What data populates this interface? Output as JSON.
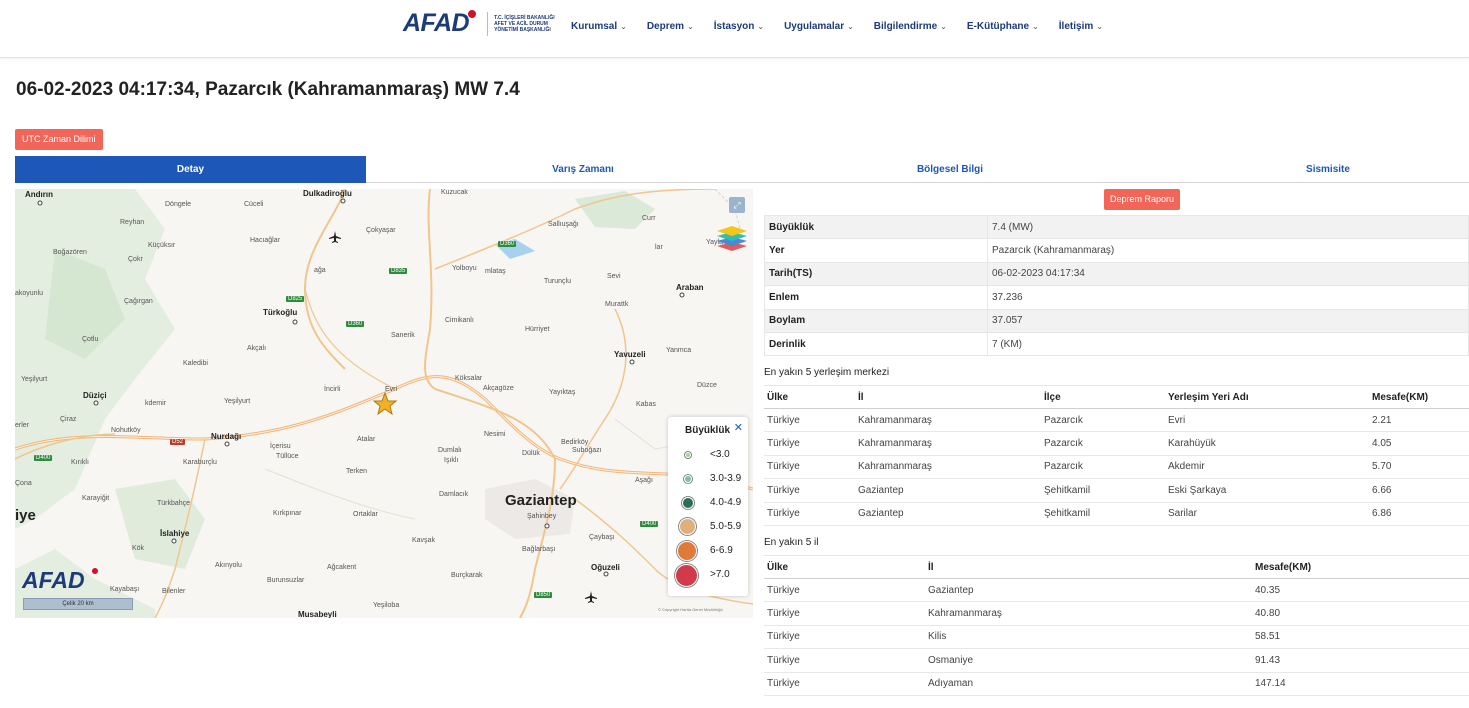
{
  "header": {
    "logo_text": "AFAD",
    "logo_subtitle": "T.C. İÇİŞLERİ BAKANLIĞI AFET VE ACİL DURUM YÖNETİMİ BAŞKANLIĞI",
    "nav": [
      {
        "label": "Kurumsal"
      },
      {
        "label": "Deprem"
      },
      {
        "label": "İstasyon"
      },
      {
        "label": "Uygulamalar"
      },
      {
        "label": "Bilgilendirme"
      },
      {
        "label": "E-Kütüphane"
      },
      {
        "label": "İletişim"
      }
    ]
  },
  "page_title": "06-02-2023 04:17:34, Pazarcık (Kahramanmaraş) MW 7.4",
  "utc_button": "UTC Zaman Dilimi",
  "tabs": [
    {
      "label": "Detay",
      "active": true
    },
    {
      "label": "Varış Zamanı",
      "active": false
    },
    {
      "label": "Bölgesel Bilgi",
      "active": false
    },
    {
      "label": "Sismisite",
      "active": false
    }
  ],
  "map": {
    "labels": {
      "andirin": "Andırın",
      "dongele": "Döngele",
      "cuceli": "Cüceli",
      "dulkadiroglu": "Dulkadiroğlu",
      "kuzucak": "Kuzucak",
      "reyhan": "Reyhan",
      "kucuksir": "Küçüksır",
      "bogazoren": "Boğazören",
      "cokyasar": "Çokyaşar",
      "haciaglar": "Hacıağlar",
      "salliusagi": "Sallıuşağı",
      "curr": "Curr",
      "sarioglan": "Sarıoğlan",
      "cokr": "Çokr",
      "agla": "ağa",
      "yolboyu": "Yolboyu",
      "mlatas": "mlataş",
      "lar": "lar",
      "sev": "Sevi",
      "yayla": "Yayla",
      "akoyunlu": "akoyunlu",
      "cagirgan": "Çağırgan",
      "turunclu": "Turunçlu",
      "araban": "Araban",
      "turkoglu": "Türkoğlu",
      "murattk": "Murattk",
      "cimikanli": "Cimikanlı",
      "hurriyet": "Hürriyet",
      "cotlu": "Çotlu",
      "akcali": "Akçalı",
      "sanerik": "Sanerik",
      "yavuzeli": "Yavuzeli",
      "yancica": "Yanmca",
      "kaledibi": "Kaledibi",
      "yesilyurt": "Yeşilyurt",
      "koksalar": "Köksalar",
      "incirli": "İncirli",
      "evri": "Evri",
      "akcagoze": "Akçagöze",
      "yayiktas": "Yayıktaş",
      "duzce": "Düzce",
      "duzici": "Düziçi",
      "kdemir": "kdemir",
      "yesilyurt2": "Yeşilyurt",
      "kabas": "Kabas",
      "ciraz": "Çiraz",
      "nohutkoy": "Nohutköy",
      "nurdagi": "Nurdağı",
      "atalar": "Atalar",
      "nesimi": "Nesimi",
      "bedirkoy": "Bedirköy",
      "erler": "erler",
      "icerisu": "İçerisu",
      "tullüce": "Tüllüce",
      "dumlali": "Dumlalı",
      "isikli": "Işıklı",
      "dulük": "Dülük",
      "subogazi": "Suboğazı",
      "kirikli": "Kırıklı",
      "karaburclu": "Karaburçlu",
      "terken": "Terken",
      "cona": "Çona",
      "karayigit": "Karayiğit",
      "turkbahce": "Türkbahçe",
      "damlacik": "Damlacık",
      "gaziantep": "Gaziantep",
      "iye": "iye",
      "kirkpinar": "Kırkpınar",
      "ortaklar": "Ortaklar",
      "sahinbey": "Şahinbey",
      "islahiye": "İslahiye",
      "kok": "Kök",
      "kavsak": "Kavşak",
      "bagbasi": "Bağlarbaşı",
      "caybasi": "Çaybaşı",
      "akinyolu": "Akınyolu",
      "agcakent": "Ağcakent",
      "oguzeli": "Oğuzeli",
      "kayabasi": "Kayabaşı",
      "bilenler": "Bilenler",
      "burunsuzlar": "Burunsuzlar",
      "burckarak": "Burçkarak",
      "celik": "Çelik",
      "musabeyli": "Musabeyli",
      "yesiloba": "Yeşiloba",
      "asgal": "Aşağı"
    },
    "roads": [
      "D835",
      "D360",
      "D825",
      "D360",
      "D52",
      "D400",
      "D400",
      "D850"
    ],
    "legend": {
      "title": "Büyüklük",
      "items": [
        {
          "label": "<3.0",
          "color": "#9fd89a"
        },
        {
          "label": "3.0-3.9",
          "color": "#7fbfb0"
        },
        {
          "label": "4.0-4.9",
          "color": "#2d6b5a"
        },
        {
          "label": "5.0-5.9",
          "color": "#e0b07a"
        },
        {
          "label": "6-6.9",
          "color": "#e07a38"
        },
        {
          "label": ">7.0",
          "color": "#d23a4a"
        }
      ]
    },
    "logo": "AFAD",
    "scale": "Çelik 20 km",
    "copyright": "© Copyright Harita Genel Müdürlüğü"
  },
  "report_button": "Deprem Raporu",
  "info": [
    {
      "key": "Büyüklük",
      "value": "7.4 (MW)"
    },
    {
      "key": "Yer",
      "value": "Pazarcık (Kahramanmaraş)"
    },
    {
      "key": "Tarih(TS)",
      "value": "06-02-2023 04:17:34"
    },
    {
      "key": "Enlem",
      "value": "37.236"
    },
    {
      "key": "Boylam",
      "value": "37.057"
    },
    {
      "key": "Derinlik",
      "value": "7 (KM)"
    }
  ],
  "near_settlements": {
    "title": "En yakın 5 yerleşim merkezi",
    "headers": [
      "Ülke",
      "İl",
      "İlçe",
      "Yerleşim Yeri Adı",
      "Mesafe(KM)"
    ],
    "rows": [
      [
        "Türkiye",
        "Kahramanmaraş",
        "Pazarcık",
        "Evri",
        "2.21"
      ],
      [
        "Türkiye",
        "Kahramanmaraş",
        "Pazarcık",
        "Karahüyük",
        "4.05"
      ],
      [
        "Türkiye",
        "Kahramanmaraş",
        "Pazarcık",
        "Akdemir",
        "5.70"
      ],
      [
        "Türkiye",
        "Gaziantep",
        "Şehitkamil",
        "Eski Şarkaya",
        "6.66"
      ],
      [
        "Türkiye",
        "Gaziantep",
        "Şehitkamil",
        "Sarilar",
        "6.86"
      ]
    ]
  },
  "near_provinces": {
    "title": "En yakın 5 il",
    "headers": [
      "Ülke",
      "İl",
      "Mesafe(KM)"
    ],
    "rows": [
      [
        "Türkiye",
        "Gaziantep",
        "40.35"
      ],
      [
        "Türkiye",
        "Kahramanmaraş",
        "40.80"
      ],
      [
        "Türkiye",
        "Kilis",
        "58.51"
      ],
      [
        "Türkiye",
        "Osmaniye",
        "91.43"
      ],
      [
        "Türkiye",
        "Adıyaman",
        "147.14"
      ]
    ]
  }
}
